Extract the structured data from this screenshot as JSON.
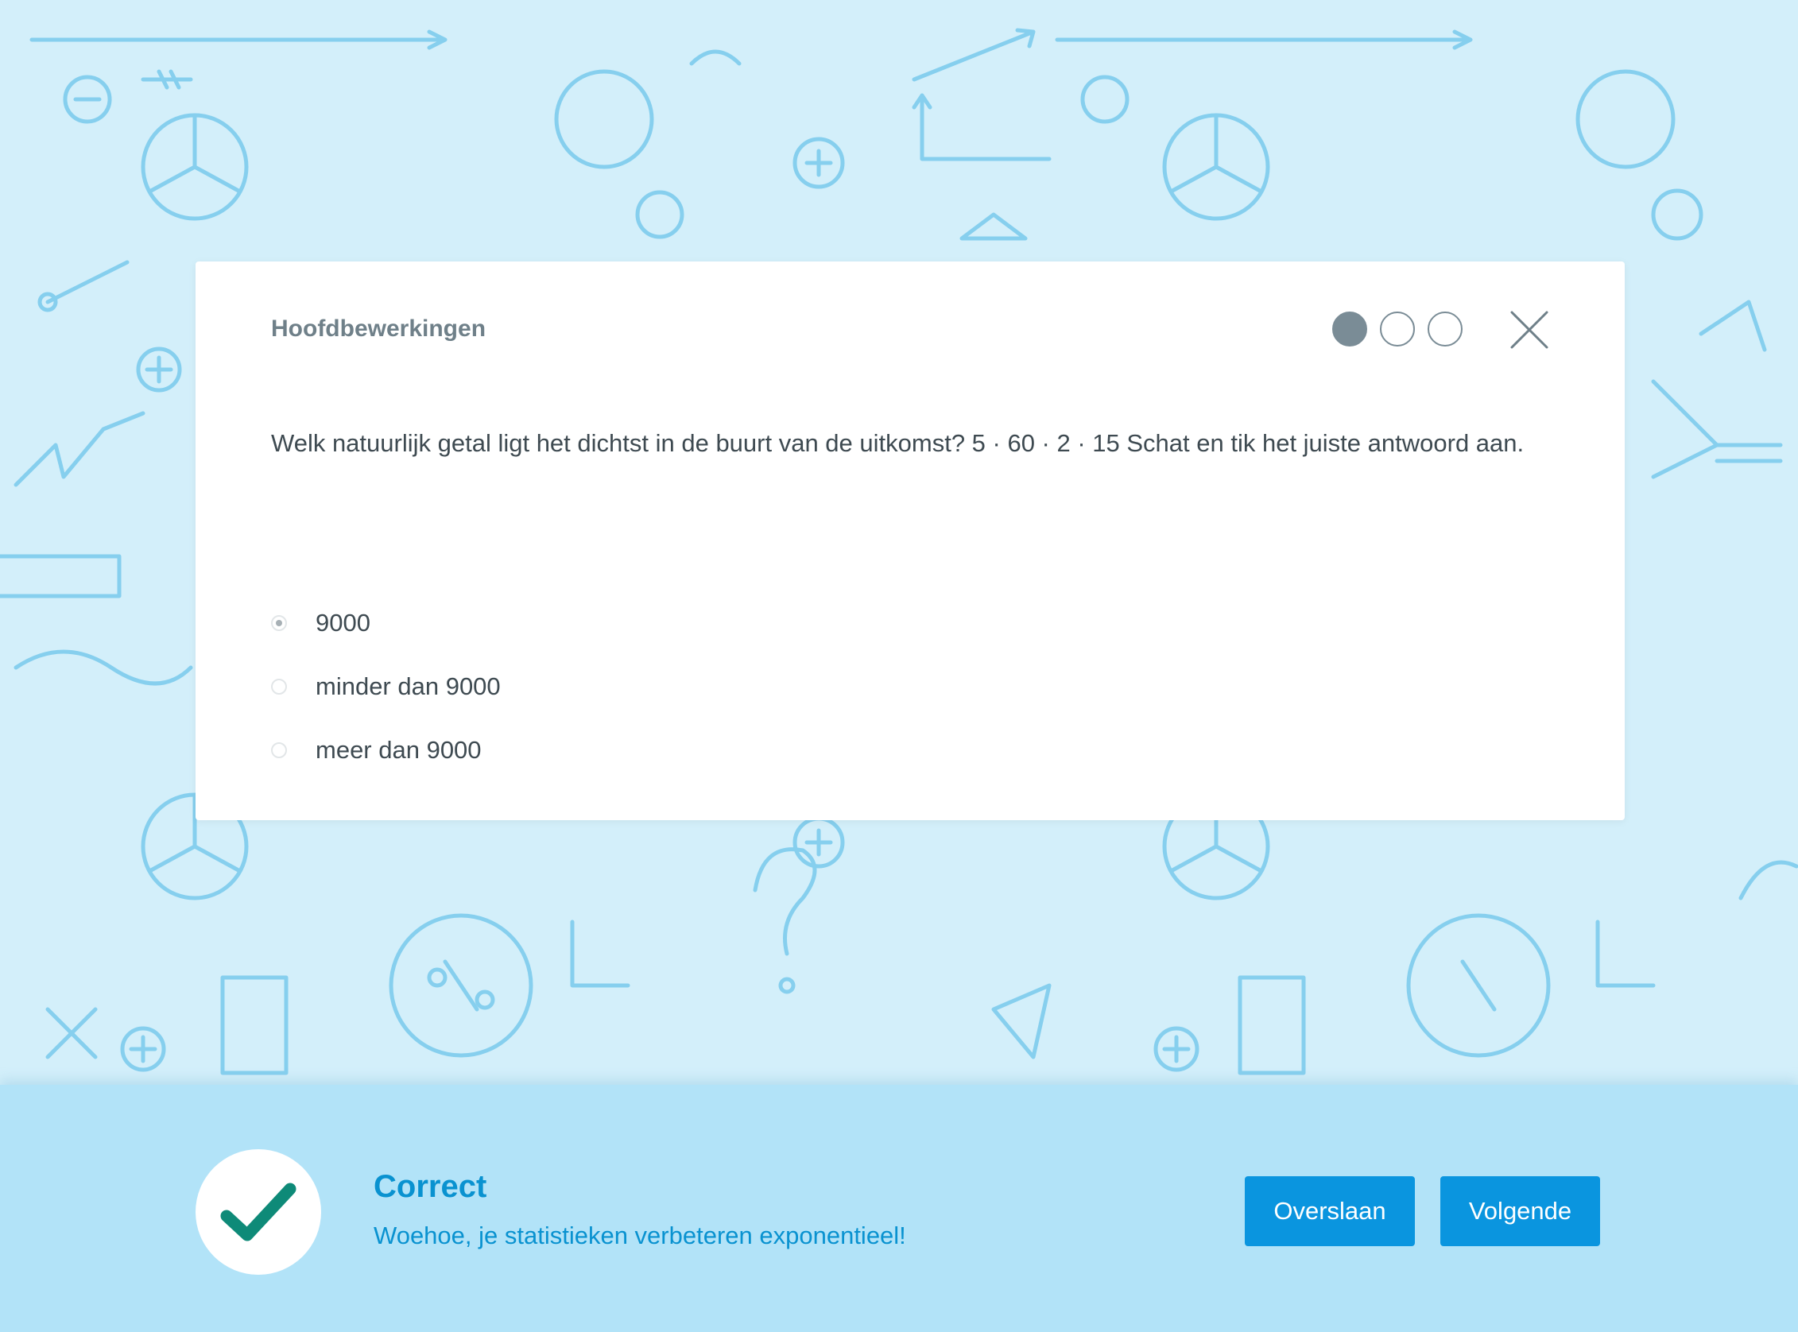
{
  "quiz": {
    "title": "Hoofdbewerkingen",
    "progress": {
      "total": 3,
      "current": 1
    },
    "question": "Welk natuurlijk getal ligt het dichtst in de buurt van de uitkomst? 5 · 60 · 2 · 15 Schat en tik het juiste antwoord aan.",
    "options": [
      {
        "label": "9000",
        "selected": true
      },
      {
        "label": "minder dan 9000",
        "selected": false
      },
      {
        "label": "meer dan 9000",
        "selected": false
      }
    ]
  },
  "feedback": {
    "status": "Correct",
    "message": "Woehoe, je statistieken verbeteren exponentieel!",
    "skip_label": "Overslaan",
    "next_label": "Volgende"
  },
  "colors": {
    "background": "#d3effa",
    "doodles": "#86cfee",
    "feedback_bar": "#b2e3f8",
    "accent_text": "#0992d0",
    "button": "#0a95df",
    "check": "#0e8a78"
  },
  "icons": {
    "close": "close-icon",
    "check": "checkmark-icon"
  }
}
